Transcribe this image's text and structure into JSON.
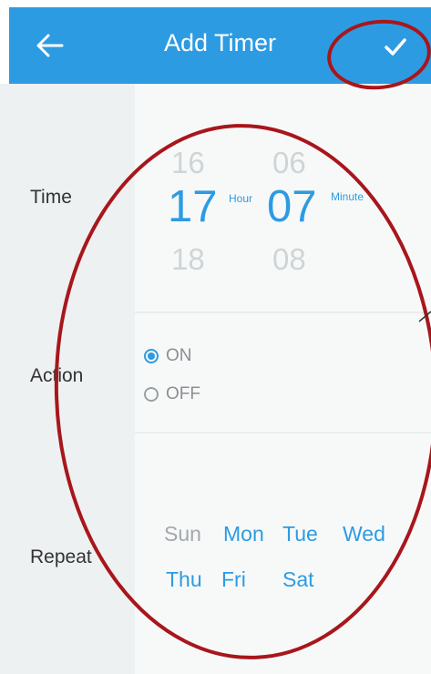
{
  "header": {
    "title": "Add Timer"
  },
  "time": {
    "label": "Time",
    "hour": {
      "prev": "16",
      "selected": "17",
      "next": "18",
      "unit": "Hour"
    },
    "minute": {
      "prev": "06",
      "selected": "07",
      "next": "08",
      "unit": "Minute"
    }
  },
  "action": {
    "label": "Action",
    "options": [
      {
        "label": "ON",
        "checked": true
      },
      {
        "label": "OFF",
        "checked": false
      }
    ]
  },
  "repeat": {
    "label": "Repeat",
    "days": [
      {
        "label": "Sun",
        "selected": false
      },
      {
        "label": "Mon",
        "selected": true
      },
      {
        "label": "Tue",
        "selected": true
      },
      {
        "label": "Wed",
        "selected": true
      },
      {
        "label": "Thu",
        "selected": true
      },
      {
        "label": "Fri",
        "selected": true
      },
      {
        "label": "Sat",
        "selected": true
      }
    ]
  },
  "colors": {
    "accent": "#2d9be2",
    "annotation": "#a8161b",
    "inactive": "#a3a8ab"
  },
  "icons": {
    "back": "arrow-left-icon",
    "confirm": "checkmark-icon"
  }
}
